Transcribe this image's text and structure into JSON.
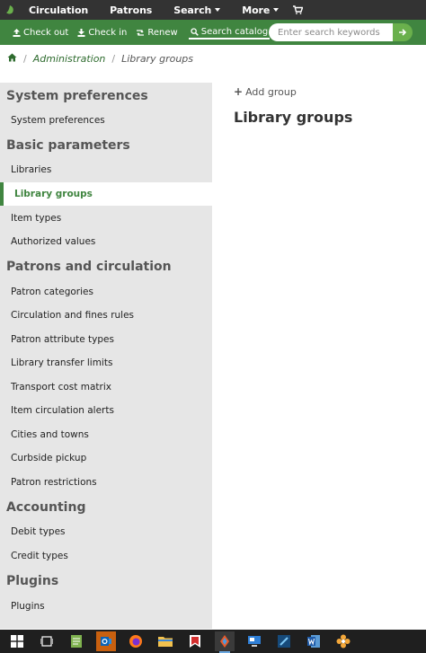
{
  "topnav": {
    "items": [
      {
        "label": "Circulation",
        "has_caret": false
      },
      {
        "label": "Patrons",
        "has_caret": false
      },
      {
        "label": "Search",
        "has_caret": true
      },
      {
        "label": "More",
        "has_caret": true
      }
    ],
    "cart_icon": "cart-icon"
  },
  "actionbar": {
    "checkout_label": "Check out",
    "checkin_label": "Check in",
    "renew_label": "Renew",
    "search_catalog_label": "Search catalog",
    "search_placeholder": "Enter search keywords"
  },
  "breadcrumb": {
    "home_icon": "home-icon",
    "link": "Administration",
    "current": "Library groups"
  },
  "sidebar": {
    "sections": [
      {
        "heading": "System preferences",
        "items": [
          {
            "label": "System preferences",
            "current": false
          }
        ]
      },
      {
        "heading": "Basic parameters",
        "items": [
          {
            "label": "Libraries",
            "current": false
          },
          {
            "label": "Library groups",
            "current": true
          },
          {
            "label": "Item types",
            "current": false
          },
          {
            "label": "Authorized values",
            "current": false
          }
        ]
      },
      {
        "heading": "Patrons and circulation",
        "items": [
          {
            "label": "Patron categories",
            "current": false
          },
          {
            "label": "Circulation and fines rules",
            "current": false
          },
          {
            "label": "Patron attribute types",
            "current": false
          },
          {
            "label": "Library transfer limits",
            "current": false
          },
          {
            "label": "Transport cost matrix",
            "current": false
          },
          {
            "label": "Item circulation alerts",
            "current": false
          },
          {
            "label": "Cities and towns",
            "current": false
          },
          {
            "label": "Curbside pickup",
            "current": false
          },
          {
            "label": "Patron restrictions",
            "current": false
          }
        ]
      },
      {
        "heading": "Accounting",
        "items": [
          {
            "label": "Debit types",
            "current": false
          },
          {
            "label": "Credit types",
            "current": false
          }
        ]
      },
      {
        "heading": "Plugins",
        "items": [
          {
            "label": "Plugins",
            "current": false
          }
        ]
      }
    ]
  },
  "main": {
    "add_group_label": "Add group",
    "title": "Library groups"
  },
  "taskbar": {
    "icons": [
      "windows-start-icon",
      "task-view-icon",
      "notepad-icon",
      "outlook-icon",
      "firefox-icon",
      "file-explorer-icon",
      "reader-icon",
      "app-icon",
      "remote-desktop-icon",
      "editor-icon",
      "word-icon",
      "flower-app-icon"
    ]
  }
}
